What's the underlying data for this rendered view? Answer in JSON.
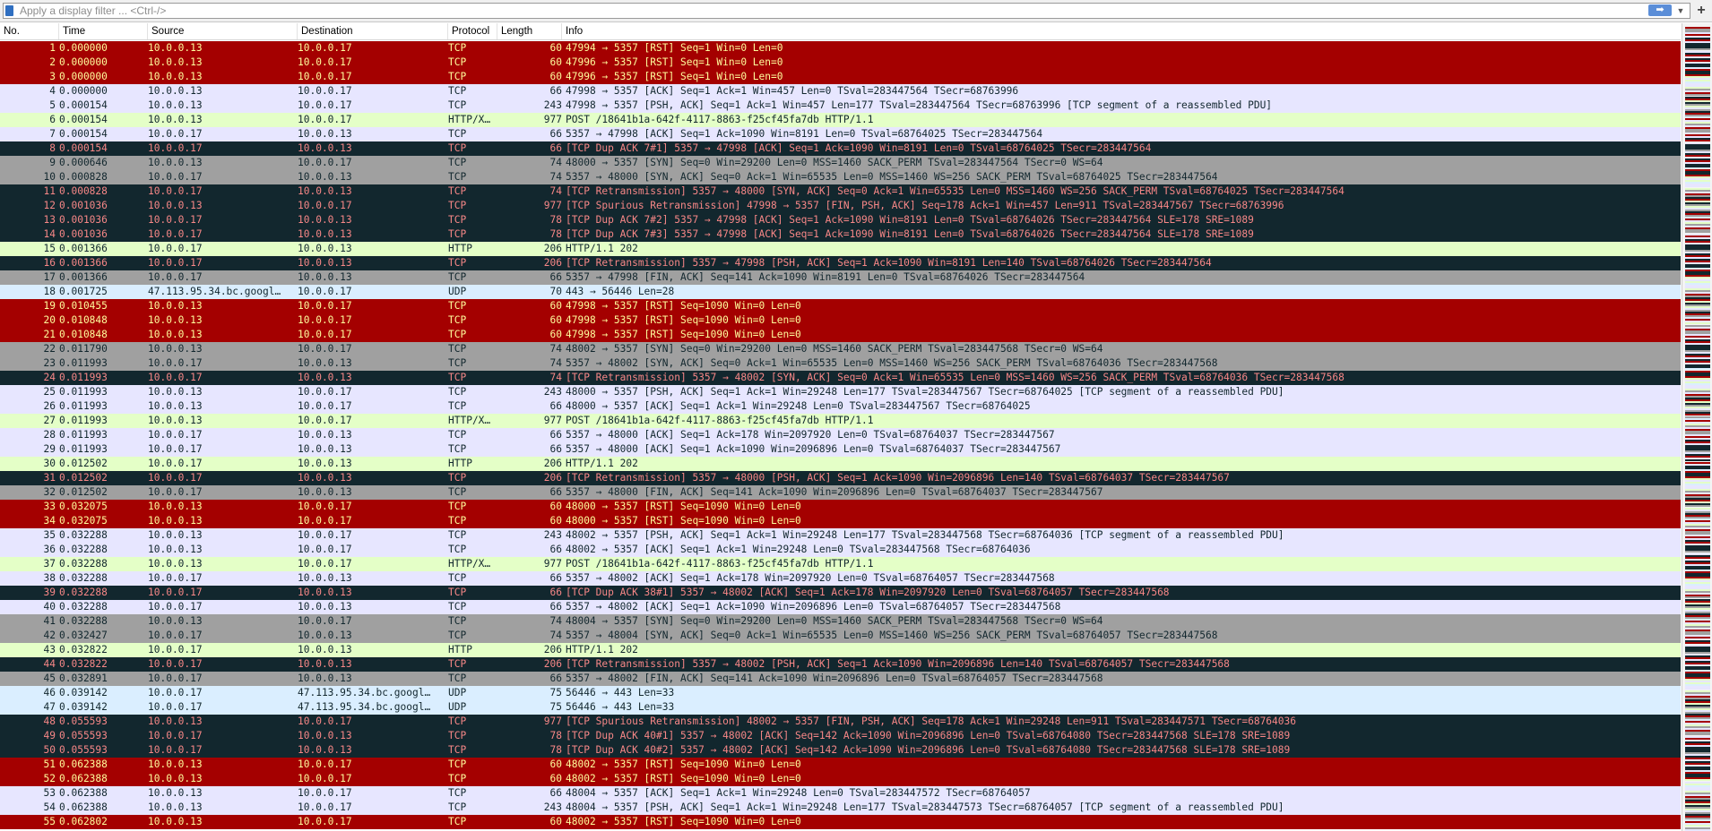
{
  "filter": {
    "placeholder": "Apply a display filter ... <Ctrl-/>",
    "apply_glyph": "➡",
    "dropdown_glyph": "▼",
    "plus_glyph": "+"
  },
  "colors": {
    "rst": {
      "bg": "#a40000",
      "fg": "#fffc9c"
    },
    "dark": {
      "bg": "#12272e",
      "fg": "#f78787"
    },
    "syn": {
      "bg": "#a0a0a0",
      "fg": "#12272e"
    },
    "tcp": {
      "bg": "#e7e6ff",
      "fg": "#12272e"
    },
    "http": {
      "bg": "#e4ffc7",
      "fg": "#12272e"
    },
    "udp": {
      "bg": "#daeeff",
      "fg": "#12272e"
    }
  },
  "columns": [
    "No.",
    "Time",
    "Source",
    "Destination",
    "Protocol",
    "Length",
    "Info"
  ],
  "packets": [
    {
      "no": "1",
      "time": "0.000000",
      "src": "10.0.0.13",
      "dst": "10.0.0.17",
      "proto": "TCP",
      "len": "60",
      "info": "47994 → 5357 [RST] Seq=1 Win=0 Len=0",
      "color": "rst"
    },
    {
      "no": "2",
      "time": "0.000000",
      "src": "10.0.0.13",
      "dst": "10.0.0.17",
      "proto": "TCP",
      "len": "60",
      "info": "47996 → 5357 [RST] Seq=1 Win=0 Len=0",
      "color": "rst"
    },
    {
      "no": "3",
      "time": "0.000000",
      "src": "10.0.0.13",
      "dst": "10.0.0.17",
      "proto": "TCP",
      "len": "60",
      "info": "47996 → 5357 [RST] Seq=1 Win=0 Len=0",
      "color": "rst"
    },
    {
      "no": "4",
      "time": "0.000000",
      "src": "10.0.0.13",
      "dst": "10.0.0.17",
      "proto": "TCP",
      "len": "66",
      "info": "47998 → 5357 [ACK] Seq=1 Ack=1 Win=457 Len=0 TSval=283447564 TSecr=68763996",
      "color": "tcp"
    },
    {
      "no": "5",
      "time": "0.000154",
      "src": "10.0.0.13",
      "dst": "10.0.0.17",
      "proto": "TCP",
      "len": "243",
      "info": "47998 → 5357 [PSH, ACK] Seq=1 Ack=1 Win=457 Len=177 TSval=283447564 TSecr=68763996 [TCP segment of a reassembled PDU]",
      "color": "tcp"
    },
    {
      "no": "6",
      "time": "0.000154",
      "src": "10.0.0.13",
      "dst": "10.0.0.17",
      "proto": "HTTP/X…",
      "len": "977",
      "info": "POST /18641b1a-642f-4117-8863-f25cf45fa7db HTTP/1.1",
      "color": "http"
    },
    {
      "no": "7",
      "time": "0.000154",
      "src": "10.0.0.17",
      "dst": "10.0.0.13",
      "proto": "TCP",
      "len": "66",
      "info": "5357 → 47998 [ACK] Seq=1 Ack=1090 Win=8191 Len=0 TSval=68764025 TSecr=283447564",
      "color": "tcp"
    },
    {
      "no": "8",
      "time": "0.000154",
      "src": "10.0.0.17",
      "dst": "10.0.0.13",
      "proto": "TCP",
      "len": "66",
      "info": "[TCP Dup ACK 7#1] 5357 → 47998 [ACK] Seq=1 Ack=1090 Win=8191 Len=0 TSval=68764025 TSecr=283447564",
      "color": "dark"
    },
    {
      "no": "9",
      "time": "0.000646",
      "src": "10.0.0.13",
      "dst": "10.0.0.17",
      "proto": "TCP",
      "len": "74",
      "info": "48000 → 5357 [SYN] Seq=0 Win=29200 Len=0 MSS=1460 SACK_PERM TSval=283447564 TSecr=0 WS=64",
      "color": "syn"
    },
    {
      "no": "10",
      "time": "0.000828",
      "src": "10.0.0.17",
      "dst": "10.0.0.13",
      "proto": "TCP",
      "len": "74",
      "info": "5357 → 48000 [SYN, ACK] Seq=0 Ack=1 Win=65535 Len=0 MSS=1460 WS=256 SACK_PERM TSval=68764025 TSecr=283447564",
      "color": "syn"
    },
    {
      "no": "11",
      "time": "0.000828",
      "src": "10.0.0.17",
      "dst": "10.0.0.13",
      "proto": "TCP",
      "len": "74",
      "info": "[TCP Retransmission] 5357 → 48000 [SYN, ACK] Seq=0 Ack=1 Win=65535 Len=0 MSS=1460 WS=256 SACK_PERM TSval=68764025 TSecr=283447564",
      "color": "dark"
    },
    {
      "no": "12",
      "time": "0.001036",
      "src": "10.0.0.13",
      "dst": "10.0.0.17",
      "proto": "TCP",
      "len": "977",
      "info": "[TCP Spurious Retransmission] 47998 → 5357 [FIN, PSH, ACK] Seq=178 Ack=1 Win=457 Len=911 TSval=283447567 TSecr=68763996",
      "color": "dark"
    },
    {
      "no": "13",
      "time": "0.001036",
      "src": "10.0.0.17",
      "dst": "10.0.0.13",
      "proto": "TCP",
      "len": "78",
      "info": "[TCP Dup ACK 7#2] 5357 → 47998 [ACK] Seq=1 Ack=1090 Win=8191 Len=0 TSval=68764026 TSecr=283447564 SLE=178 SRE=1089",
      "color": "dark"
    },
    {
      "no": "14",
      "time": "0.001036",
      "src": "10.0.0.17",
      "dst": "10.0.0.13",
      "proto": "TCP",
      "len": "78",
      "info": "[TCP Dup ACK 7#3] 5357 → 47998 [ACK] Seq=1 Ack=1090 Win=8191 Len=0 TSval=68764026 TSecr=283447564 SLE=178 SRE=1089",
      "color": "dark"
    },
    {
      "no": "15",
      "time": "0.001366",
      "src": "10.0.0.17",
      "dst": "10.0.0.13",
      "proto": "HTTP",
      "len": "206",
      "info": "HTTP/1.1 202",
      "color": "http"
    },
    {
      "no": "16",
      "time": "0.001366",
      "src": "10.0.0.17",
      "dst": "10.0.0.13",
      "proto": "TCP",
      "len": "206",
      "info": "[TCP Retransmission] 5357 → 47998 [PSH, ACK] Seq=1 Ack=1090 Win=8191 Len=140 TSval=68764026 TSecr=283447564",
      "color": "dark"
    },
    {
      "no": "17",
      "time": "0.001366",
      "src": "10.0.0.17",
      "dst": "10.0.0.13",
      "proto": "TCP",
      "len": "66",
      "info": "5357 → 47998 [FIN, ACK] Seq=141 Ack=1090 Win=8191 Len=0 TSval=68764026 TSecr=283447564",
      "color": "syn"
    },
    {
      "no": "18",
      "time": "0.001725",
      "src": "47.113.95.34.bc.googl…",
      "dst": "10.0.0.17",
      "proto": "UDP",
      "len": "70",
      "info": "443 → 56446 Len=28",
      "color": "udp"
    },
    {
      "no": "19",
      "time": "0.010455",
      "src": "10.0.0.13",
      "dst": "10.0.0.17",
      "proto": "TCP",
      "len": "60",
      "info": "47998 → 5357 [RST] Seq=1090 Win=0 Len=0",
      "color": "rst"
    },
    {
      "no": "20",
      "time": "0.010848",
      "src": "10.0.0.13",
      "dst": "10.0.0.17",
      "proto": "TCP",
      "len": "60",
      "info": "47998 → 5357 [RST] Seq=1090 Win=0 Len=0",
      "color": "rst"
    },
    {
      "no": "21",
      "time": "0.010848",
      "src": "10.0.0.13",
      "dst": "10.0.0.17",
      "proto": "TCP",
      "len": "60",
      "info": "47998 → 5357 [RST] Seq=1090 Win=0 Len=0",
      "color": "rst"
    },
    {
      "no": "22",
      "time": "0.011790",
      "src": "10.0.0.13",
      "dst": "10.0.0.17",
      "proto": "TCP",
      "len": "74",
      "info": "48002 → 5357 [SYN] Seq=0 Win=29200 Len=0 MSS=1460 SACK_PERM TSval=283447568 TSecr=0 WS=64",
      "color": "syn"
    },
    {
      "no": "23",
      "time": "0.011993",
      "src": "10.0.0.17",
      "dst": "10.0.0.13",
      "proto": "TCP",
      "len": "74",
      "info": "5357 → 48002 [SYN, ACK] Seq=0 Ack=1 Win=65535 Len=0 MSS=1460 WS=256 SACK_PERM TSval=68764036 TSecr=283447568",
      "color": "syn"
    },
    {
      "no": "24",
      "time": "0.011993",
      "src": "10.0.0.17",
      "dst": "10.0.0.13",
      "proto": "TCP",
      "len": "74",
      "info": "[TCP Retransmission] 5357 → 48002 [SYN, ACK] Seq=0 Ack=1 Win=65535 Len=0 MSS=1460 WS=256 SACK_PERM TSval=68764036 TSecr=283447568",
      "color": "dark"
    },
    {
      "no": "25",
      "time": "0.011993",
      "src": "10.0.0.13",
      "dst": "10.0.0.17",
      "proto": "TCP",
      "len": "243",
      "info": "48000 → 5357 [PSH, ACK] Seq=1 Ack=1 Win=29248 Len=177 TSval=283447567 TSecr=68764025 [TCP segment of a reassembled PDU]",
      "color": "tcp"
    },
    {
      "no": "26",
      "time": "0.011993",
      "src": "10.0.0.13",
      "dst": "10.0.0.17",
      "proto": "TCP",
      "len": "66",
      "info": "48000 → 5357 [ACK] Seq=1 Ack=1 Win=29248 Len=0 TSval=283447567 TSecr=68764025",
      "color": "tcp"
    },
    {
      "no": "27",
      "time": "0.011993",
      "src": "10.0.0.13",
      "dst": "10.0.0.17",
      "proto": "HTTP/X…",
      "len": "977",
      "info": "POST /18641b1a-642f-4117-8863-f25cf45fa7db HTTP/1.1",
      "color": "http"
    },
    {
      "no": "28",
      "time": "0.011993",
      "src": "10.0.0.17",
      "dst": "10.0.0.13",
      "proto": "TCP",
      "len": "66",
      "info": "5357 → 48000 [ACK] Seq=1 Ack=178 Win=2097920 Len=0 TSval=68764037 TSecr=283447567",
      "color": "tcp"
    },
    {
      "no": "29",
      "time": "0.011993",
      "src": "10.0.0.17",
      "dst": "10.0.0.13",
      "proto": "TCP",
      "len": "66",
      "info": "5357 → 48000 [ACK] Seq=1 Ack=1090 Win=2096896 Len=0 TSval=68764037 TSecr=283447567",
      "color": "tcp"
    },
    {
      "no": "30",
      "time": "0.012502",
      "src": "10.0.0.17",
      "dst": "10.0.0.13",
      "proto": "HTTP",
      "len": "206",
      "info": "HTTP/1.1 202",
      "color": "http"
    },
    {
      "no": "31",
      "time": "0.012502",
      "src": "10.0.0.17",
      "dst": "10.0.0.13",
      "proto": "TCP",
      "len": "206",
      "info": "[TCP Retransmission] 5357 → 48000 [PSH, ACK] Seq=1 Ack=1090 Win=2096896 Len=140 TSval=68764037 TSecr=283447567",
      "color": "dark"
    },
    {
      "no": "32",
      "time": "0.012502",
      "src": "10.0.0.17",
      "dst": "10.0.0.13",
      "proto": "TCP",
      "len": "66",
      "info": "5357 → 48000 [FIN, ACK] Seq=141 Ack=1090 Win=2096896 Len=0 TSval=68764037 TSecr=283447567",
      "color": "syn"
    },
    {
      "no": "33",
      "time": "0.032075",
      "src": "10.0.0.13",
      "dst": "10.0.0.17",
      "proto": "TCP",
      "len": "60",
      "info": "48000 → 5357 [RST] Seq=1090 Win=0 Len=0",
      "color": "rst"
    },
    {
      "no": "34",
      "time": "0.032075",
      "src": "10.0.0.13",
      "dst": "10.0.0.17",
      "proto": "TCP",
      "len": "60",
      "info": "48000 → 5357 [RST] Seq=1090 Win=0 Len=0",
      "color": "rst"
    },
    {
      "no": "35",
      "time": "0.032288",
      "src": "10.0.0.13",
      "dst": "10.0.0.17",
      "proto": "TCP",
      "len": "243",
      "info": "48002 → 5357 [PSH, ACK] Seq=1 Ack=1 Win=29248 Len=177 TSval=283447568 TSecr=68764036 [TCP segment of a reassembled PDU]",
      "color": "tcp"
    },
    {
      "no": "36",
      "time": "0.032288",
      "src": "10.0.0.13",
      "dst": "10.0.0.17",
      "proto": "TCP",
      "len": "66",
      "info": "48002 → 5357 [ACK] Seq=1 Ack=1 Win=29248 Len=0 TSval=283447568 TSecr=68764036",
      "color": "tcp"
    },
    {
      "no": "37",
      "time": "0.032288",
      "src": "10.0.0.13",
      "dst": "10.0.0.17",
      "proto": "HTTP/X…",
      "len": "977",
      "info": "POST /18641b1a-642f-4117-8863-f25cf45fa7db HTTP/1.1",
      "color": "http"
    },
    {
      "no": "38",
      "time": "0.032288",
      "src": "10.0.0.17",
      "dst": "10.0.0.13",
      "proto": "TCP",
      "len": "66",
      "info": "5357 → 48002 [ACK] Seq=1 Ack=178 Win=2097920 Len=0 TSval=68764057 TSecr=283447568",
      "color": "tcp"
    },
    {
      "no": "39",
      "time": "0.032288",
      "src": "10.0.0.17",
      "dst": "10.0.0.13",
      "proto": "TCP",
      "len": "66",
      "info": "[TCP Dup ACK 38#1] 5357 → 48002 [ACK] Seq=1 Ack=178 Win=2097920 Len=0 TSval=68764057 TSecr=283447568",
      "color": "dark"
    },
    {
      "no": "40",
      "time": "0.032288",
      "src": "10.0.0.17",
      "dst": "10.0.0.13",
      "proto": "TCP",
      "len": "66",
      "info": "5357 → 48002 [ACK] Seq=1 Ack=1090 Win=2096896 Len=0 TSval=68764057 TSecr=283447568",
      "color": "tcp"
    },
    {
      "no": "41",
      "time": "0.032288",
      "src": "10.0.0.13",
      "dst": "10.0.0.17",
      "proto": "TCP",
      "len": "74",
      "info": "48004 → 5357 [SYN] Seq=0 Win=29200 Len=0 MSS=1460 SACK_PERM TSval=283447568 TSecr=0 WS=64",
      "color": "syn"
    },
    {
      "no": "42",
      "time": "0.032427",
      "src": "10.0.0.17",
      "dst": "10.0.0.13",
      "proto": "TCP",
      "len": "74",
      "info": "5357 → 48004 [SYN, ACK] Seq=0 Ack=1 Win=65535 Len=0 MSS=1460 WS=256 SACK_PERM TSval=68764057 TSecr=283447568",
      "color": "syn"
    },
    {
      "no": "43",
      "time": "0.032822",
      "src": "10.0.0.17",
      "dst": "10.0.0.13",
      "proto": "HTTP",
      "len": "206",
      "info": "HTTP/1.1 202",
      "color": "http"
    },
    {
      "no": "44",
      "time": "0.032822",
      "src": "10.0.0.17",
      "dst": "10.0.0.13",
      "proto": "TCP",
      "len": "206",
      "info": "[TCP Retransmission] 5357 → 48002 [PSH, ACK] Seq=1 Ack=1090 Win=2096896 Len=140 TSval=68764057 TSecr=283447568",
      "color": "dark"
    },
    {
      "no": "45",
      "time": "0.032891",
      "src": "10.0.0.17",
      "dst": "10.0.0.13",
      "proto": "TCP",
      "len": "66",
      "info": "5357 → 48002 [FIN, ACK] Seq=141 Ack=1090 Win=2096896 Len=0 TSval=68764057 TSecr=283447568",
      "color": "syn"
    },
    {
      "no": "46",
      "time": "0.039142",
      "src": "10.0.0.17",
      "dst": "47.113.95.34.bc.googl…",
      "proto": "UDP",
      "len": "75",
      "info": "56446 → 443 Len=33",
      "color": "udp"
    },
    {
      "no": "47",
      "time": "0.039142",
      "src": "10.0.0.17",
      "dst": "47.113.95.34.bc.googl…",
      "proto": "UDP",
      "len": "75",
      "info": "56446 → 443 Len=33",
      "color": "udp"
    },
    {
      "no": "48",
      "time": "0.055593",
      "src": "10.0.0.13",
      "dst": "10.0.0.17",
      "proto": "TCP",
      "len": "977",
      "info": "[TCP Spurious Retransmission] 48002 → 5357 [FIN, PSH, ACK] Seq=178 Ack=1 Win=29248 Len=911 TSval=283447571 TSecr=68764036",
      "color": "dark"
    },
    {
      "no": "49",
      "time": "0.055593",
      "src": "10.0.0.17",
      "dst": "10.0.0.13",
      "proto": "TCP",
      "len": "78",
      "info": "[TCP Dup ACK 40#1] 5357 → 48002 [ACK] Seq=142 Ack=1090 Win=2096896 Len=0 TSval=68764080 TSecr=283447568 SLE=178 SRE=1089",
      "color": "dark"
    },
    {
      "no": "50",
      "time": "0.055593",
      "src": "10.0.0.17",
      "dst": "10.0.0.13",
      "proto": "TCP",
      "len": "78",
      "info": "[TCP Dup ACK 40#2] 5357 → 48002 [ACK] Seq=142 Ack=1090 Win=2096896 Len=0 TSval=68764080 TSecr=283447568 SLE=178 SRE=1089",
      "color": "dark"
    },
    {
      "no": "51",
      "time": "0.062388",
      "src": "10.0.0.13",
      "dst": "10.0.0.17",
      "proto": "TCP",
      "len": "60",
      "info": "48002 → 5357 [RST] Seq=1090 Win=0 Len=0",
      "color": "rst"
    },
    {
      "no": "52",
      "time": "0.062388",
      "src": "10.0.0.13",
      "dst": "10.0.0.17",
      "proto": "TCP",
      "len": "60",
      "info": "48002 → 5357 [RST] Seq=1090 Win=0 Len=0",
      "color": "rst"
    },
    {
      "no": "53",
      "time": "0.062388",
      "src": "10.0.0.13",
      "dst": "10.0.0.17",
      "proto": "TCP",
      "len": "66",
      "info": "48004 → 5357 [ACK] Seq=1 Ack=1 Win=29248 Len=0 TSval=283447572 TSecr=68764057",
      "color": "tcp"
    },
    {
      "no": "54",
      "time": "0.062388",
      "src": "10.0.0.13",
      "dst": "10.0.0.17",
      "proto": "TCP",
      "len": "243",
      "info": "48004 → 5357 [PSH, ACK] Seq=1 Ack=1 Win=29248 Len=177 TSval=283447573 TSecr=68764057 [TCP segment of a reassembled PDU]",
      "color": "tcp"
    },
    {
      "no": "55",
      "time": "0.062802",
      "src": "10.0.0.13",
      "dst": "10.0.0.17",
      "proto": "TCP",
      "len": "60",
      "info": "48002 → 5357 [RST] Seq=1090 Win=0 Len=0",
      "color": "rst"
    }
  ]
}
